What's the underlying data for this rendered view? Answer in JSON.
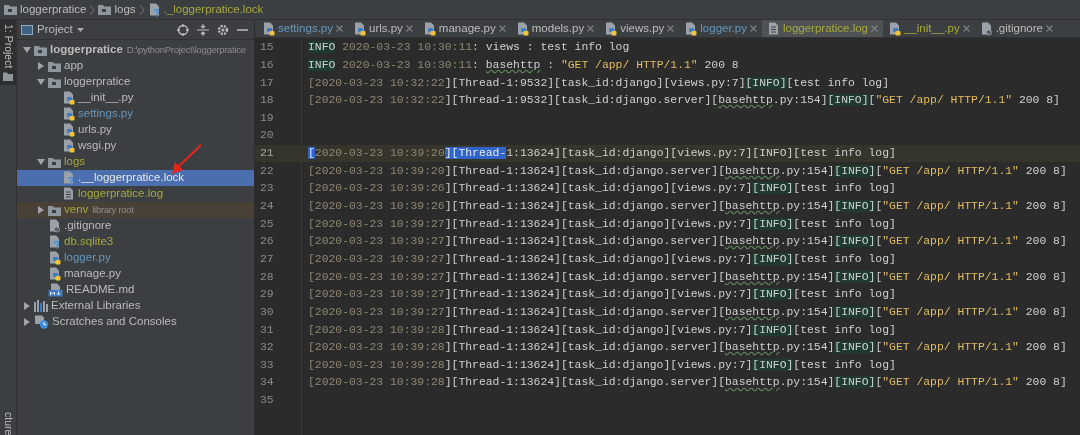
{
  "breadcrumb": [
    {
      "label": "loggerpratice",
      "kind": "folder",
      "color": "#bbbbbb"
    },
    {
      "label": "logs",
      "kind": "folder",
      "color": "#bbbbbb"
    },
    {
      "label": "._loggerpratice.lock",
      "kind": "unknown",
      "color": "#a8a83c"
    }
  ],
  "tool_strip": {
    "top": [
      {
        "label": "1: Project",
        "selected": true
      }
    ],
    "bottom": [
      {
        "label": "cture",
        "selected": false
      }
    ]
  },
  "project_panel": {
    "title": "Project",
    "tree": [
      {
        "label": "loggerpratice",
        "hint": "D:\\pythonProject\\loggerpratice",
        "kind": "folder",
        "color": "#bbbbbb",
        "bold": true,
        "expanded": true,
        "selected": false,
        "children": [
          {
            "label": "app",
            "kind": "folder",
            "color": "#bbbbbb",
            "expanded": false,
            "selected": false
          },
          {
            "label": "loggerpratice",
            "kind": "folder",
            "color": "#bbbbbb",
            "expanded": true,
            "selected": false,
            "children": [
              {
                "label": "__init__.py",
                "kind": "python",
                "color": "#bbbbbb",
                "selected": false
              },
              {
                "label": "settings.py",
                "kind": "python",
                "color": "#6897bb",
                "selected": false
              },
              {
                "label": "urls.py",
                "kind": "python",
                "color": "#bbbbbb",
                "selected": false
              },
              {
                "label": "wsgi.py",
                "kind": "python",
                "color": "#bbbbbb",
                "selected": false
              }
            ]
          },
          {
            "label": "logs",
            "kind": "folder",
            "color": "#a8a83c",
            "expanded": true,
            "selected": false,
            "children": [
              {
                "label": ".__loggerpratice.lock",
                "kind": "unknown",
                "selected": true
              },
              {
                "label": "loggerpratice.log",
                "kind": "text",
                "color": "#a8a83c",
                "selected": false
              }
            ]
          },
          {
            "label": "venv",
            "hint": "library root",
            "kind": "folder",
            "color": "#a8a83c",
            "excluded": true,
            "expanded": false,
            "selected": false
          },
          {
            "label": ".gitignore",
            "kind": "ignore",
            "color": "#bbbbbb",
            "selected": false
          },
          {
            "label": "db.sqlite3",
            "kind": "unknown",
            "color": "#a8a83c",
            "selected": false
          },
          {
            "label": "logger.py",
            "kind": "python",
            "color": "#6897bb",
            "selected": false
          },
          {
            "label": "manage.py",
            "kind": "python",
            "color": "#bbbbbb",
            "selected": false
          },
          {
            "label": "README.md",
            "kind": "markdown",
            "color": "#bbbbbb",
            "selected": false
          }
        ]
      },
      {
        "label": "External Libraries",
        "kind": "libraries",
        "color": "#bbbbbb",
        "expanded": false,
        "selected": false
      },
      {
        "label": "Scratches and Consoles",
        "kind": "scratches",
        "color": "#bbbbbb",
        "expanded": false,
        "selected": false
      }
    ]
  },
  "annotations": [
    {
      "kind": "arrow"
    }
  ],
  "tabs": [
    {
      "label": "settings.py",
      "kind": "python",
      "color": "#6897bb",
      "selected": false
    },
    {
      "label": "urls.py",
      "kind": "python",
      "color": "#bbbbbb",
      "selected": false
    },
    {
      "label": "manage.py",
      "kind": "python",
      "color": "#bbbbbb",
      "selected": false
    },
    {
      "label": "models.py",
      "kind": "python",
      "color": "#bbbbbb",
      "selected": false
    },
    {
      "label": "views.py",
      "kind": "python",
      "color": "#bbbbbb",
      "selected": false
    },
    {
      "label": "logger.py",
      "kind": "python",
      "color": "#6897bb",
      "selected": false
    },
    {
      "label": "loggerpratice.log",
      "kind": "text",
      "color": "#a8a83c",
      "selected": true
    },
    {
      "label": "__init__.py",
      "kind": "python",
      "color": "#a8a83c",
      "selected": false
    },
    {
      "label": ".gitignore",
      "kind": "ignore",
      "color": "#bbbbbb",
      "selected": false
    }
  ],
  "lines": [
    {
      "number": "15",
      "current": false,
      "segments": [
        {
          "kind": "info",
          "text": "INFO"
        },
        {
          "kind": "date",
          "text": " 2020-03-23 10:30:11"
        },
        {
          "kind": "plain",
          "text": ": views : test info log"
        }
      ]
    },
    {
      "number": "16",
      "current": false,
      "segments": [
        {
          "kind": "info",
          "text": "INFO"
        },
        {
          "kind": "date",
          "text": " 2020-03-23 10:30:11"
        },
        {
          "kind": "plain",
          "text": ": "
        },
        {
          "kind": "underline",
          "text": "basehttp"
        },
        {
          "kind": "plain",
          "text": " : "
        },
        {
          "kind": "string",
          "text": "\"GET /app/ HTTP/1.1\""
        },
        {
          "kind": "plain",
          "text": " 200 8"
        }
      ]
    },
    {
      "number": "17",
      "current": false,
      "segments": [
        {
          "kind": "date",
          "text": "[2020-03-23 10:32:22"
        },
        {
          "kind": "plain",
          "text": "][Thread-1:9532][task_id:django][views.py:7]"
        },
        {
          "kind": "info",
          "text": "[INFO]"
        },
        {
          "kind": "plain",
          "text": "[test info log]"
        }
      ]
    },
    {
      "number": "18",
      "current": false,
      "segments": [
        {
          "kind": "date",
          "text": "[2020-03-23 10:32:22"
        },
        {
          "kind": "plain",
          "text": "][Thread-1:9532][task_id:django.server]["
        },
        {
          "kind": "underline",
          "text": "basehttp"
        },
        {
          "kind": "plain",
          "text": ".py:154]"
        },
        {
          "kind": "info",
          "text": "[INFO]"
        },
        {
          "kind": "plain",
          "text": "["
        },
        {
          "kind": "string",
          "text": "\"GET /app/ HTTP/1.1\""
        },
        {
          "kind": "plain",
          "text": " 200 8]"
        }
      ]
    },
    {
      "number": "19",
      "current": false
    },
    {
      "number": "20",
      "current": false
    },
    {
      "number": "21",
      "current": true,
      "segments": [
        {
          "kind": "selected",
          "text": "["
        },
        {
          "kind": "date",
          "text": "2020-03-23 10:39:20"
        },
        {
          "kind": "selected",
          "text": "][Thread-"
        },
        {
          "kind": "plain",
          "text": "1:13624][task_id:django][views.py:7][INFO][test info log]"
        }
      ]
    },
    {
      "number": "22",
      "current": false,
      "segments": [
        {
          "kind": "date",
          "text": "[2020-03-23 10:39:20"
        },
        {
          "kind": "plain",
          "text": "][Thread-1:13624][task_id:django.server]["
        },
        {
          "kind": "underline",
          "text": "basehttp"
        },
        {
          "kind": "plain",
          "text": ".py:154]"
        },
        {
          "kind": "info",
          "text": "[INFO]"
        },
        {
          "kind": "plain",
          "text": "["
        },
        {
          "kind": "string",
          "text": "\"GET /app/ HTTP/1.1\""
        },
        {
          "kind": "plain",
          "text": " 200 8]"
        }
      ]
    },
    {
      "number": "23",
      "current": false,
      "segments": [
        {
          "kind": "date",
          "text": "[2020-03-23 10:39:26"
        },
        {
          "kind": "plain",
          "text": "][Thread-1:13624][task_id:django][views.py:7]"
        },
        {
          "kind": "info",
          "text": "[INFO]"
        },
        {
          "kind": "plain",
          "text": "[test info log]"
        }
      ]
    },
    {
      "number": "24",
      "current": false,
      "segments": [
        {
          "kind": "date",
          "text": "[2020-03-23 10:39:26"
        },
        {
          "kind": "plain",
          "text": "][Thread-1:13624][task_id:django.server]["
        },
        {
          "kind": "underline",
          "text": "basehttp"
        },
        {
          "kind": "plain",
          "text": ".py:154]"
        },
        {
          "kind": "info",
          "text": "[INFO]"
        },
        {
          "kind": "plain",
          "text": "["
        },
        {
          "kind": "string",
          "text": "\"GET /app/ HTTP/1.1\""
        },
        {
          "kind": "plain",
          "text": " 200 8]"
        }
      ]
    },
    {
      "number": "25",
      "current": false,
      "segments": [
        {
          "kind": "date",
          "text": "[2020-03-23 10:39:27"
        },
        {
          "kind": "plain",
          "text": "][Thread-1:13624][task_id:django][views.py:7]"
        },
        {
          "kind": "info",
          "text": "[INFO]"
        },
        {
          "kind": "plain",
          "text": "[test info log]"
        }
      ]
    },
    {
      "number": "26",
      "current": false,
      "segments": [
        {
          "kind": "date",
          "text": "[2020-03-23 10:39:27"
        },
        {
          "kind": "plain",
          "text": "][Thread-1:13624][task_id:django.server]["
        },
        {
          "kind": "underline",
          "text": "basehttp"
        },
        {
          "kind": "plain",
          "text": ".py:154]"
        },
        {
          "kind": "info",
          "text": "[INFO]"
        },
        {
          "kind": "plain",
          "text": "["
        },
        {
          "kind": "string",
          "text": "\"GET /app/ HTTP/1.1\""
        },
        {
          "kind": "plain",
          "text": " 200 8]"
        }
      ]
    },
    {
      "number": "27",
      "current": false,
      "segments": [
        {
          "kind": "date",
          "text": "[2020-03-23 10:39:27"
        },
        {
          "kind": "plain",
          "text": "][Thread-1:13624][task_id:django][views.py:7]"
        },
        {
          "kind": "info",
          "text": "[INFO]"
        },
        {
          "kind": "plain",
          "text": "[test info log]"
        }
      ]
    },
    {
      "number": "28",
      "current": false,
      "segments": [
        {
          "kind": "date",
          "text": "[2020-03-23 10:39:27"
        },
        {
          "kind": "plain",
          "text": "][Thread-1:13624][task_id:django.server]["
        },
        {
          "kind": "underline",
          "text": "basehttp"
        },
        {
          "kind": "plain",
          "text": ".py:154]"
        },
        {
          "kind": "info",
          "text": "[INFO]"
        },
        {
          "kind": "plain",
          "text": "["
        },
        {
          "kind": "string",
          "text": "\"GET /app/ HTTP/1.1\""
        },
        {
          "kind": "plain",
          "text": " 200 8]"
        }
      ]
    },
    {
      "number": "29",
      "current": false,
      "segments": [
        {
          "kind": "date",
          "text": "[2020-03-23 10:39:27"
        },
        {
          "kind": "plain",
          "text": "][Thread-1:13624][task_id:django][views.py:7]"
        },
        {
          "kind": "info",
          "text": "[INFO]"
        },
        {
          "kind": "plain",
          "text": "[test info log]"
        }
      ]
    },
    {
      "number": "30",
      "current": false,
      "segments": [
        {
          "kind": "date",
          "text": "[2020-03-23 10:39:27"
        },
        {
          "kind": "plain",
          "text": "][Thread-1:13624][task_id:django.server]["
        },
        {
          "kind": "underline",
          "text": "basehttp"
        },
        {
          "kind": "plain",
          "text": ".py:154]"
        },
        {
          "kind": "info",
          "text": "[INFO]"
        },
        {
          "kind": "plain",
          "text": "["
        },
        {
          "kind": "string",
          "text": "\"GET /app/ HTTP/1.1\""
        },
        {
          "kind": "plain",
          "text": " 200 8]"
        }
      ]
    },
    {
      "number": "31",
      "current": false,
      "segments": [
        {
          "kind": "date",
          "text": "[2020-03-23 10:39:28"
        },
        {
          "kind": "plain",
          "text": "][Thread-1:13624][task_id:django][views.py:7]"
        },
        {
          "kind": "info",
          "text": "[INFO]"
        },
        {
          "kind": "plain",
          "text": "[test info log]"
        }
      ]
    },
    {
      "number": "32",
      "current": false,
      "segments": [
        {
          "kind": "date",
          "text": "[2020-03-23 10:39:28"
        },
        {
          "kind": "plain",
          "text": "][Thread-1:13624][task_id:django.server]["
        },
        {
          "kind": "underline",
          "text": "basehttp"
        },
        {
          "kind": "plain",
          "text": ".py:154]"
        },
        {
          "kind": "info",
          "text": "[INFO]"
        },
        {
          "kind": "plain",
          "text": "["
        },
        {
          "kind": "string",
          "text": "\"GET /app/ HTTP/1.1\""
        },
        {
          "kind": "plain",
          "text": " 200 8]"
        }
      ]
    },
    {
      "number": "33",
      "current": false,
      "segments": [
        {
          "kind": "date",
          "text": "[2020-03-23 10:39:28"
        },
        {
          "kind": "plain",
          "text": "][Thread-1:13624][task_id:django][views.py:7]"
        },
        {
          "kind": "info",
          "text": "[INFO]"
        },
        {
          "kind": "plain",
          "text": "[test info log]"
        }
      ]
    },
    {
      "number": "34",
      "current": false,
      "segments": [
        {
          "kind": "date",
          "text": "[2020-03-23 10:39:28"
        },
        {
          "kind": "plain",
          "text": "][Thread-1:13624][task_id:django.server]["
        },
        {
          "kind": "underline",
          "text": "basehttp"
        },
        {
          "kind": "plain",
          "text": ".py:154]"
        },
        {
          "kind": "info",
          "text": "[INFO]"
        },
        {
          "kind": "plain",
          "text": "["
        },
        {
          "kind": "string",
          "text": "\"GET /app/ HTTP/1.1\""
        },
        {
          "kind": "plain",
          "text": " 200 8]"
        }
      ]
    },
    {
      "number": "35",
      "current": false
    }
  ]
}
